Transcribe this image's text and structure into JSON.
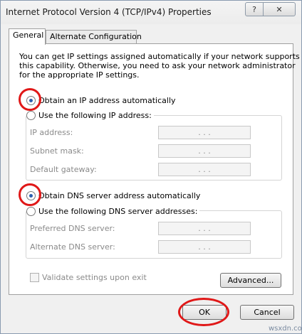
{
  "window": {
    "title": "Internet Protocol Version 4 (TCP/IPv4) Properties",
    "help_glyph": "?",
    "close_glyph": "✕"
  },
  "tabs": [
    {
      "label": "General",
      "active": true
    },
    {
      "label": "Alternate Configuration",
      "active": false
    }
  ],
  "description": {
    "line1": "You can get IP settings assigned automatically if your network supports",
    "line2": "this capability. Otherwise, you need to ask your network administrator",
    "line3": "for the appropriate IP settings."
  },
  "ip": {
    "auto_label": "Obtain an IP address automatically",
    "manual_label": "Use the following IP address:",
    "auto_selected": true,
    "fields": [
      {
        "label": "IP address:",
        "value": ". . ."
      },
      {
        "label": "Subnet mask:",
        "value": ". . ."
      },
      {
        "label": "Default gateway:",
        "value": ". . ."
      }
    ]
  },
  "dns": {
    "auto_label": "Obtain DNS server address automatically",
    "manual_label": "Use the following DNS server addresses:",
    "auto_selected": true,
    "fields": [
      {
        "label": "Preferred DNS server:",
        "value": ". . ."
      },
      {
        "label": "Alternate DNS server:",
        "value": ". . ."
      }
    ]
  },
  "validate_label": "Validate settings upon exit",
  "buttons": {
    "advanced": "Advanced...",
    "ok": "OK",
    "cancel": "Cancel"
  },
  "watermark": "wsxdn.com",
  "colors": {
    "highlight_circle": "#e01818",
    "radio_dot": "#2a5fb0"
  }
}
